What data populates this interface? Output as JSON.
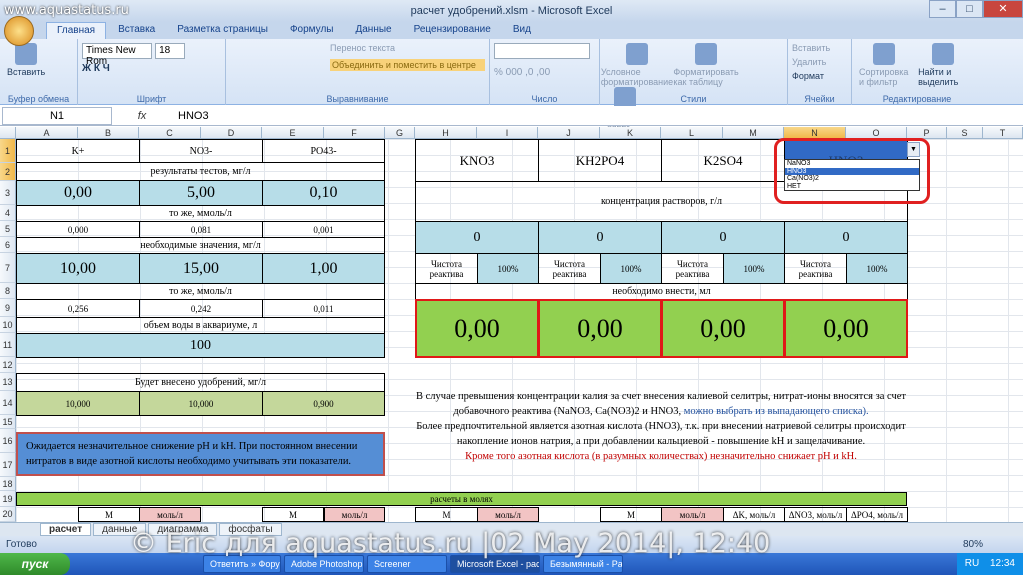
{
  "window": {
    "title": "расчет удобрений.xlsm - Microsoft Excel",
    "watermark": "www.aquastatus.ru"
  },
  "tabs": [
    "Главная",
    "Вставка",
    "Разметка страницы",
    "Формулы",
    "Данные",
    "Рецензирование",
    "Вид"
  ],
  "ribbon": {
    "paste": "Вставить",
    "clipboard_group": "Буфер обмена",
    "font_name": "Times New Rom",
    "font_size": "18",
    "font_group": "Шрифт",
    "wrap_text": "Перенос текста",
    "merge_center": "Объединить и поместить в центре",
    "align_group": "Выравнивание",
    "number_group": "Число",
    "cond_format": "Условное форматирование",
    "format_table": "Форматировать как таблицу",
    "cell_styles": "Стили ячеек",
    "styles_group": "Стили",
    "insert": "Вставить",
    "delete": "Удалить",
    "format": "Формат",
    "cells_group": "Ячейки",
    "sort_filter": "Сортировка и фильтр",
    "find_select": "Найти и выделить",
    "editing_group": "Редактирование"
  },
  "formula_bar": {
    "name_box": "N1",
    "fx": "fx",
    "content": "HNO3"
  },
  "columns": [
    "A",
    "B",
    "C",
    "D",
    "E",
    "F",
    "G",
    "H",
    "I",
    "J",
    "K",
    "L",
    "M",
    "N",
    "O",
    "P",
    "S",
    "T"
  ],
  "rows": [
    "1",
    "2",
    "3",
    "4",
    "5",
    "6",
    "7",
    "8",
    "9",
    "10",
    "11",
    "12",
    "13",
    "14",
    "15",
    "16",
    "17",
    "18",
    "19",
    "20"
  ],
  "left": {
    "h_k": "K+",
    "h_no3": "NO3-",
    "h_po4": "PO43-",
    "tests_label": "результаты тестов, мг/л",
    "tests": [
      "0,00",
      "5,00",
      "0,10"
    ],
    "mmol_label": "то же, ммоль/л",
    "mmol": [
      "0,000",
      "0,081",
      "0,001"
    ],
    "needed_label": "необходимые значения, мг/л",
    "needed": [
      "10,00",
      "15,00",
      "1,00"
    ],
    "mmol2_label": "то же, ммоль/л",
    "mmol2": [
      "0,256",
      "0,242",
      "0,011"
    ],
    "water_label": "объем воды в аквариуме, л",
    "water": "100",
    "will_add_label": "Будет внесено удобрений, мг/л",
    "will_add": [
      "10,000",
      "10,000",
      "0,900"
    ],
    "note": "Ожидается незначительное снижение pH и kH. При постоянном внесении нитратов в виде азотной кислоты необходимо учитывать эти показатели."
  },
  "right": {
    "reagents": [
      "KNO3",
      "KH2PO4",
      "K2SO4",
      "HNO3"
    ],
    "conc_label": "концентрация растворов, г/л",
    "conc": [
      "0",
      "0",
      "0",
      "0"
    ],
    "purity_label": "Чистота реактива",
    "purity": [
      "100%",
      "100%",
      "100%",
      "100%"
    ],
    "need_label": "необходимо внести, мл",
    "need": [
      "0,00",
      "0,00",
      "0,00",
      "0,00"
    ],
    "dropdown": [
      "NaNO3",
      "HNO3",
      "Ca(NO3)2",
      "НЕТ"
    ],
    "para1": "В случае превышения концентрации калия за счет внесения калиевой селитры, нитрат-ионы вносятся за счет добавочного реактива (NaNO3, Ca(NO3)2 и HNO3,",
    "para1_link": "можно выбрать из выпадающего списка).",
    "para2": "Более предпочтительной является азотная кислота (HNO3), т.к. при внесении натриевой селитры происходит накопление ионов натрия, а при добавлении кальциевой - повышение kH и защелачивание.",
    "para3": "Кроме того азотная кислота (в разумных количествах) незначительно снижает pH и kH."
  },
  "moles_label": "расчеты в молях",
  "row20": {
    "m1": "M",
    "u1": "моль/л",
    "m2": "M",
    "u2": "моль/л",
    "m3": "M",
    "u3": "моль/л",
    "m4": "M",
    "u4": "моль/л",
    "dk": "ΔK, моль/л",
    "dno3": "ΔNO3, моль/л",
    "dpo4": "ΔPO4, моль/л"
  },
  "sheets": [
    "расчет",
    "данные",
    "диаграмма",
    "фосфаты"
  ],
  "status": {
    "ready": "Готово",
    "zoom": "80%"
  },
  "taskbar": {
    "start": "пуск",
    "items": [
      "Ответить » Форум а...",
      "Adobe Photoshop CS...",
      "Screener",
      "Microsoft Excel - расч...",
      "Безымянный - Paint"
    ],
    "clock": "12:34",
    "lang": "RU"
  },
  "copyright": "© Eric для aquastatus.ru |02 May 2014|, 12:40"
}
